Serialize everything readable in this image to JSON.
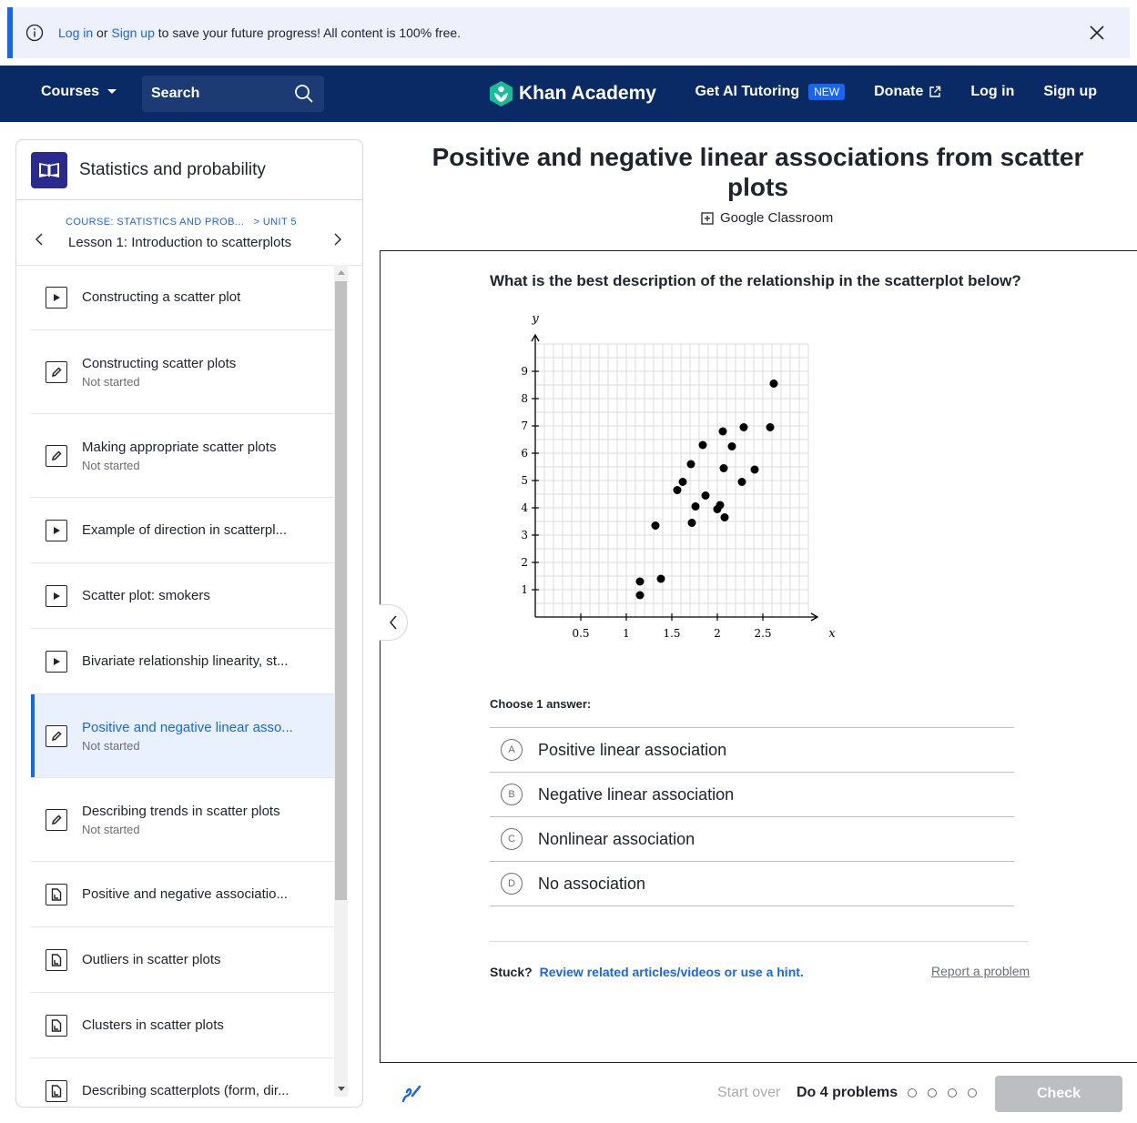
{
  "banner": {
    "login": "Log in",
    "or": "or",
    "signup": "Sign up",
    "rest": "to save your future progress! All content is 100% free."
  },
  "nav": {
    "courses": "Courses",
    "search_placeholder": "Search",
    "logo": "Khan Academy",
    "ai_tutoring": "Get AI Tutoring",
    "new_badge": "NEW",
    "donate": "Donate",
    "login": "Log in",
    "signup": "Sign up",
    "colors": {
      "navy": "#0a2a66",
      "accent": "#1865f2",
      "logo_green": "#14bf96"
    }
  },
  "sidebar": {
    "course_title": "Statistics and probability",
    "crumb_course": "COURSE: STATISTICS AND PROB...",
    "crumb_unit": "> UNIT 5",
    "lesson": "Lesson 1: Introduction to scatterplots",
    "items": [
      {
        "label": "Constructing a scatter plot",
        "status": "",
        "icon": "video-icon"
      },
      {
        "label": "Constructing scatter plots",
        "status": "Not started",
        "icon": "pencil-icon"
      },
      {
        "label": "Making appropriate scatter plots",
        "status": "Not started",
        "icon": "pencil-icon"
      },
      {
        "label": "Example of direction in scatterpl...",
        "status": "",
        "icon": "video-icon"
      },
      {
        "label": "Scatter plot: smokers",
        "status": "",
        "icon": "video-icon"
      },
      {
        "label": "Bivariate relationship linearity, st...",
        "status": "",
        "icon": "video-icon"
      },
      {
        "label": "Positive and negative linear asso...",
        "status": "Not started",
        "icon": "pencil-icon",
        "active": true
      },
      {
        "label": "Describing trends in scatter plots",
        "status": "Not started",
        "icon": "pencil-icon"
      },
      {
        "label": "Positive and negative associatio...",
        "status": "",
        "icon": "article-icon"
      },
      {
        "label": "Outliers in scatter plots",
        "status": "",
        "icon": "article-icon"
      },
      {
        "label": "Clusters in scatter plots",
        "status": "",
        "icon": "article-icon"
      },
      {
        "label": "Describing scatterplots (form, dir...",
        "status": "",
        "icon": "article-icon"
      }
    ]
  },
  "main": {
    "title": "Positive and negative linear associations from scatter plots",
    "classroom": "Google Classroom",
    "question": "What is the best description of the relationship in the scatterplot below?",
    "choose": "Choose 1 answer:",
    "answers": [
      {
        "letter": "A",
        "text": "Positive linear association"
      },
      {
        "letter": "B",
        "text": "Negative linear association"
      },
      {
        "letter": "C",
        "text": "Nonlinear association"
      },
      {
        "letter": "D",
        "text": "No association"
      }
    ],
    "stuck": "Stuck?",
    "stuck_link": "Review related articles/videos or use a hint.",
    "report": "Report a problem"
  },
  "chart_data": {
    "type": "scatter",
    "xlabel": "x",
    "ylabel": "y",
    "xlim": [
      0,
      3
    ],
    "ylim": [
      0,
      10
    ],
    "xticks": [
      "0.5",
      "1",
      "1.5",
      "2",
      "2.5"
    ],
    "yticks": [
      "1",
      "2",
      "3",
      "4",
      "5",
      "6",
      "7",
      "8",
      "9"
    ],
    "grid": true,
    "points": [
      [
        1.15,
        0.8
      ],
      [
        1.15,
        1.3
      ],
      [
        1.38,
        1.4
      ],
      [
        1.32,
        3.35
      ],
      [
        1.72,
        3.45
      ],
      [
        1.76,
        4.05
      ],
      [
        1.87,
        4.45
      ],
      [
        1.56,
        4.65
      ],
      [
        1.62,
        4.95
      ],
      [
        1.71,
        5.6
      ],
      [
        1.84,
        6.3
      ],
      [
        2.06,
        6.8
      ],
      [
        2.16,
        6.25
      ],
      [
        2.29,
        6.95
      ],
      [
        2.07,
        5.45
      ],
      [
        2.27,
        4.95
      ],
      [
        2.41,
        5.4
      ],
      [
        2.0,
        3.95
      ],
      [
        2.03,
        4.1
      ],
      [
        2.08,
        3.65
      ],
      [
        2.58,
        6.95
      ],
      [
        2.62,
        8.55
      ]
    ]
  },
  "footer": {
    "start_over": "Start over",
    "do_problems": "Do 4 problems",
    "check": "Check"
  }
}
